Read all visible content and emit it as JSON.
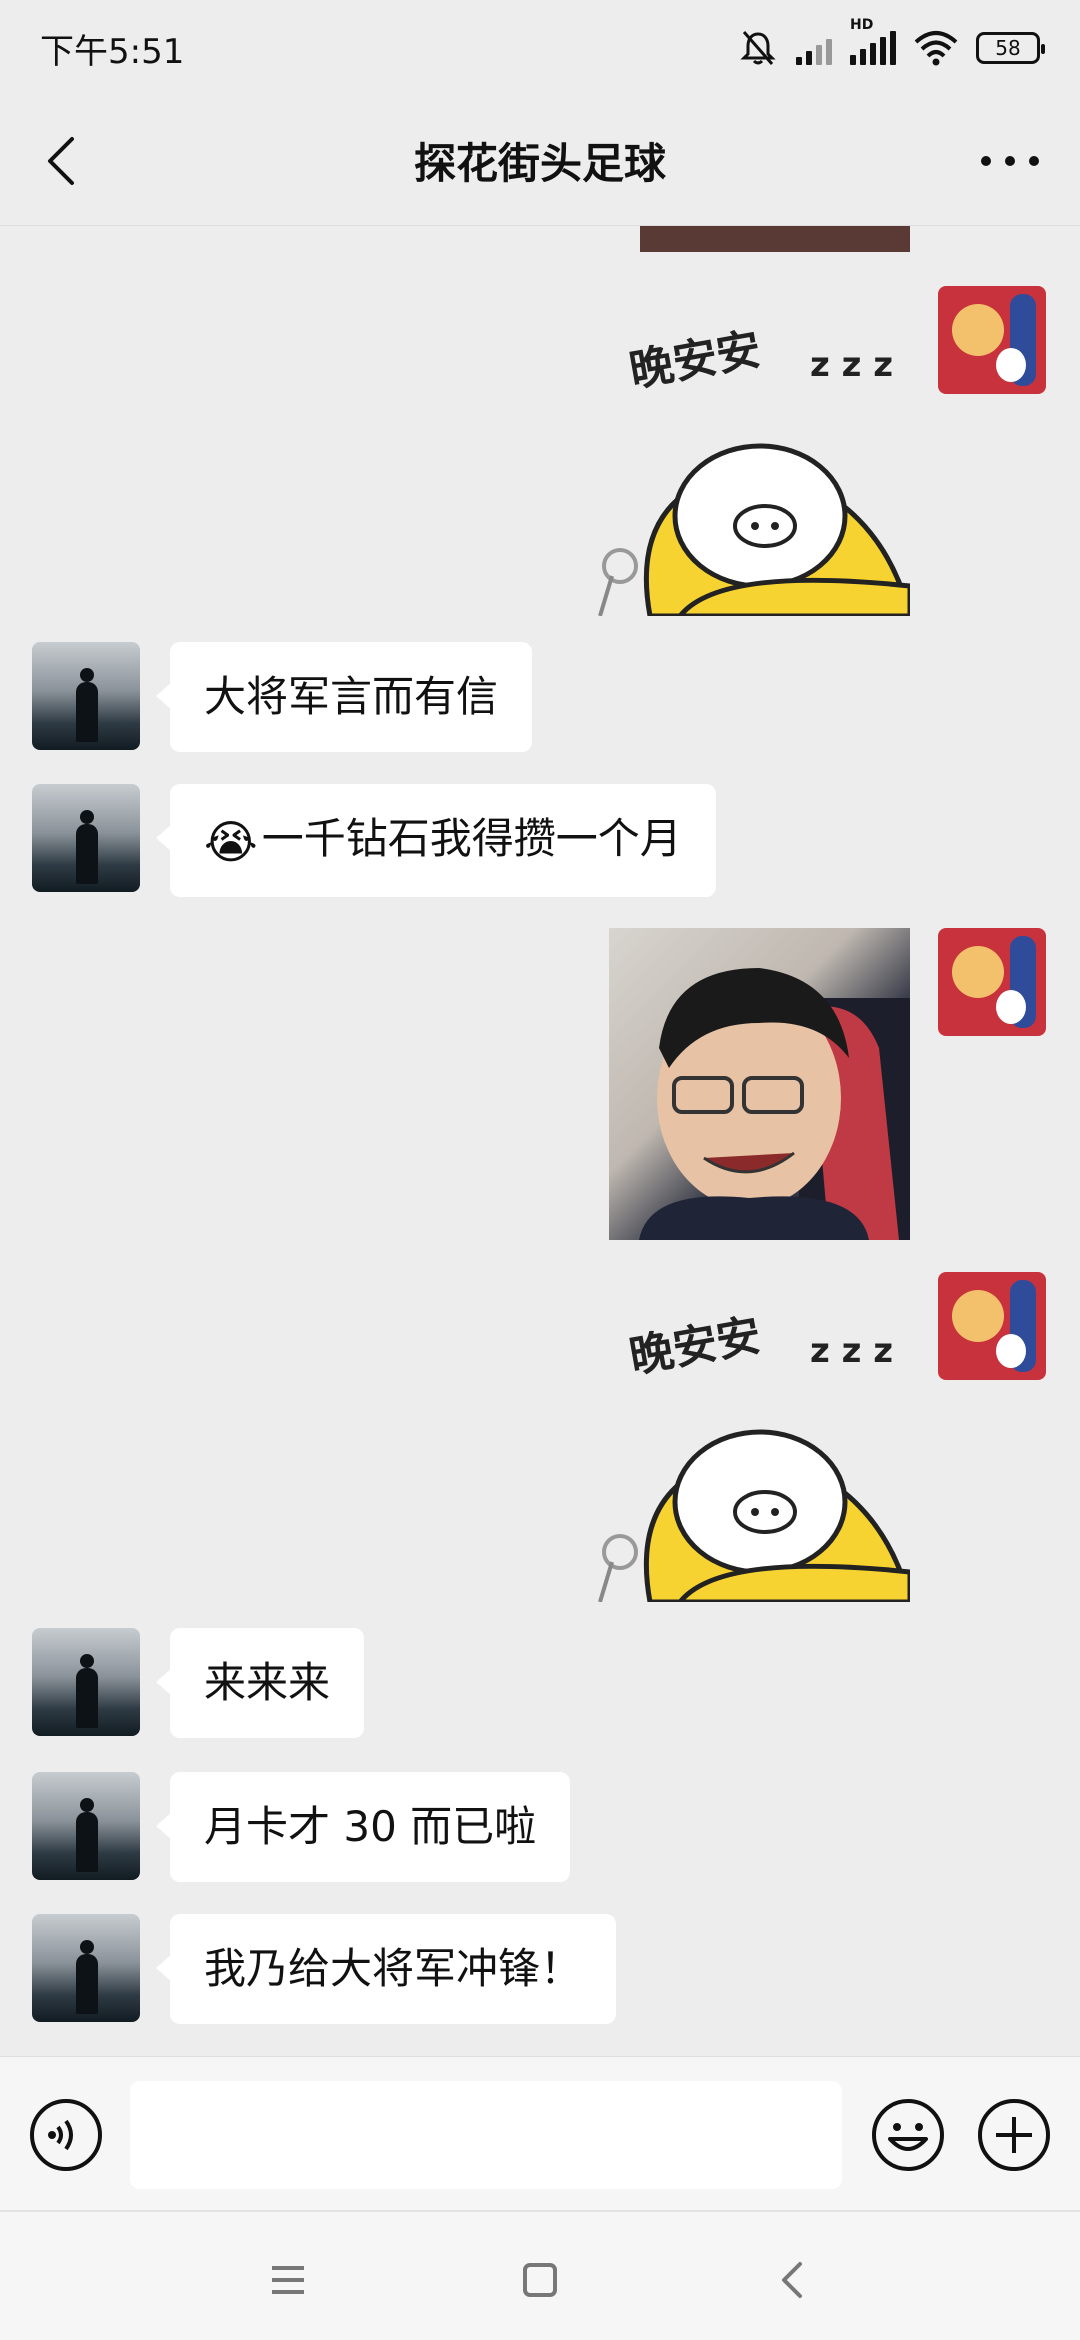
{
  "status_bar": {
    "time": "下午5:51",
    "battery": "58",
    "hd_label": "HD"
  },
  "header": {
    "title": "探花街头足球"
  },
  "messages": [
    {
      "from": "self",
      "type": "sticker",
      "caption": "晚安安",
      "zzz": "z z z"
    },
    {
      "from": "other",
      "type": "text",
      "text": "大将军言而有信"
    },
    {
      "from": "other",
      "type": "text",
      "emoji": "😭",
      "text": "一千钻石我得攒一个月"
    },
    {
      "from": "self",
      "type": "image"
    },
    {
      "from": "self",
      "type": "sticker",
      "caption": "晚安安",
      "zzz": "z z z"
    },
    {
      "from": "other",
      "type": "text",
      "text": "来来来"
    },
    {
      "from": "other",
      "type": "text",
      "text": "月卡才 30 而已啦"
    },
    {
      "from": "other",
      "type": "text",
      "text": "我乃给大将军冲锋！"
    }
  ],
  "input": {
    "value": "",
    "placeholder": ""
  },
  "icons": {
    "back": "chevron-left-icon",
    "more": "more-icon",
    "voice": "voice-icon",
    "emoji": "emoji-icon",
    "plus": "plus-icon",
    "mute": "bell-off-icon",
    "signal": "signal-icon",
    "wifi": "wifi-icon",
    "battery": "battery-icon"
  },
  "colors": {
    "chat_bg": "#ededed",
    "bubble_other": "#ffffff",
    "header_bg": "#ededed"
  }
}
